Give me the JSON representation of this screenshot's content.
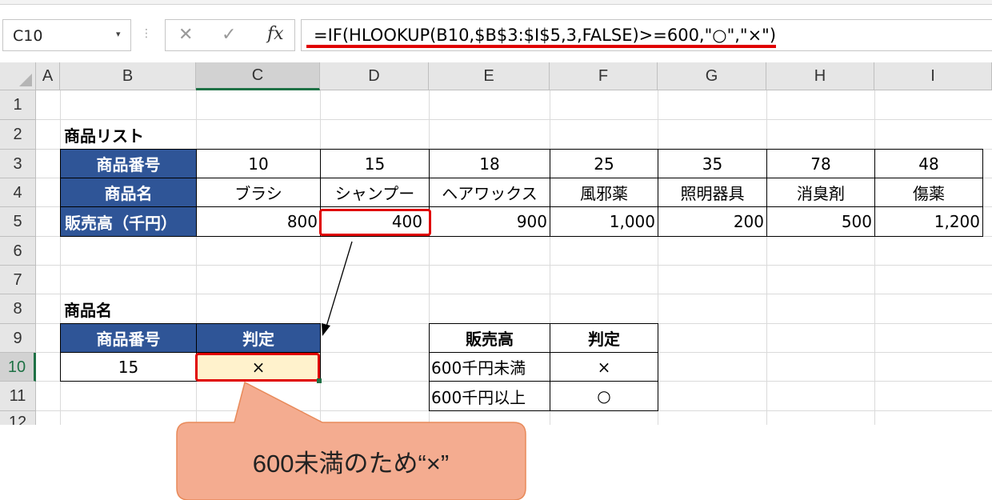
{
  "formula_bar": {
    "name_box": "C10",
    "formula": "=IF(HLOOKUP(B10,$B$3:$I$5,3,FALSE)>=600,\"○\",\"×\")"
  },
  "columns": [
    "A",
    "B",
    "C",
    "D",
    "E",
    "F",
    "G",
    "H",
    "I"
  ],
  "selected_column": "C",
  "rows": [
    "1",
    "2",
    "3",
    "4",
    "5",
    "6",
    "7",
    "8",
    "9",
    "10",
    "11",
    "12"
  ],
  "selected_row": "10",
  "product_list": {
    "title": "商品リスト",
    "header_number": "商品番号",
    "header_name": "商品名",
    "header_sales": "販売高（千円）",
    "numbers": [
      "10",
      "15",
      "18",
      "25",
      "35",
      "78",
      "48"
    ],
    "names": [
      "ブラシ",
      "シャンプー",
      "ヘアワックス",
      "風邪薬",
      "照明器具",
      "消臭剤",
      "傷薬"
    ],
    "sales": [
      "800",
      "400",
      "900",
      "1,000",
      "200",
      "500",
      "1,200"
    ]
  },
  "lookup": {
    "title": "商品名",
    "header_number": "商品番号",
    "header_judge": "判定",
    "input_number": "15",
    "result": "×"
  },
  "criteria": {
    "header_sales": "販売高",
    "header_judge": "判定",
    "row1_label": "600千円未満",
    "row1_mark": "×",
    "row2_label": "600千円以上",
    "row2_mark": "○"
  },
  "callout": {
    "text": "600未満のため“×”",
    "color": "#f4ac90",
    "border_color": "#e88a5a"
  },
  "colors": {
    "header_fill": "#2f5597",
    "highlight_fill": "#fff2cc",
    "annotation_red": "#e00000",
    "selection_green": "#1e7145"
  }
}
